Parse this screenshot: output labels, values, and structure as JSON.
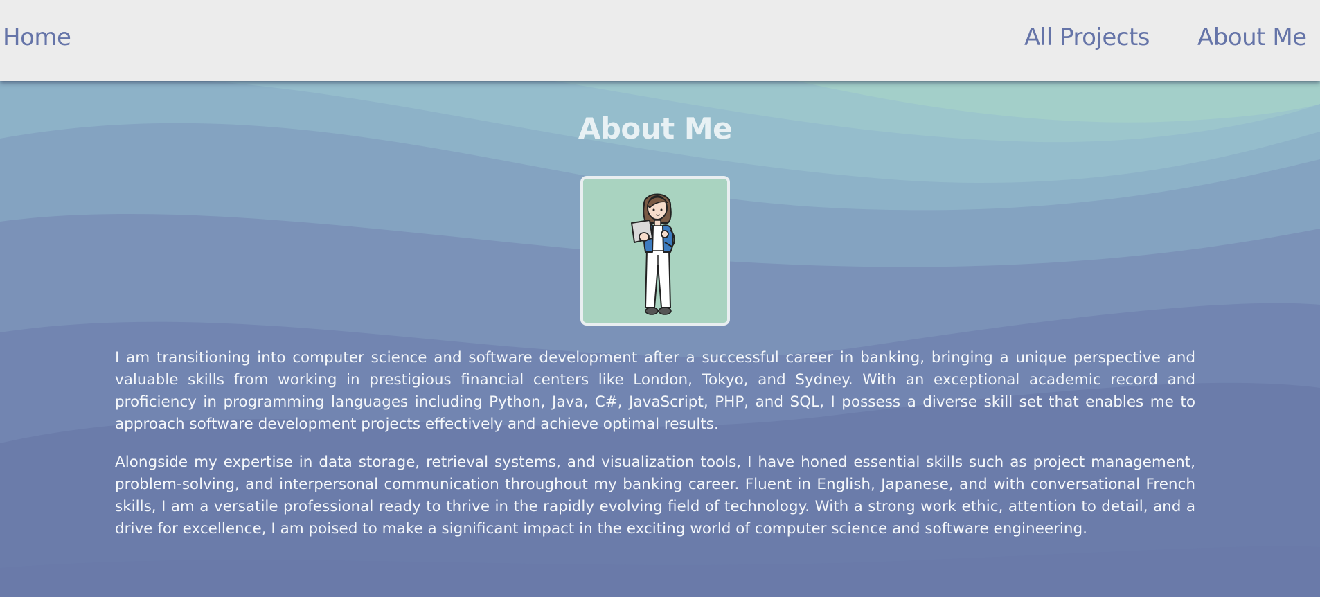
{
  "nav": {
    "home_label": "Home",
    "projects_label": "All Projects",
    "about_label": "About Me"
  },
  "main": {
    "title": "About Me",
    "portrait": {
      "icon": "woman-with-laptop-illustration",
      "background_color": "#a9d3c0"
    },
    "paragraphs": [
      "I am transitioning into computer science and software development after a successful career in banking, bringing a unique perspective and valuable skills from working in prestigious financial centers like London, Tokyo, and Sydney. With an exceptional academic record and proficiency in programming languages including Python, Java, C#, JavaScript, PHP, and SQL, I possess a diverse skill set that enables me to approach software development projects effectively and achieve optimal results.",
      "Alongside my expertise in data storage, retrieval systems, and visualization tools, I have honed essential skills such as project management, problem-solving, and interpersonal communication throughout my banking career. Fluent in English, Japanese, and with conversational French skills, I am a versatile professional ready to thrive in the rapidly evolving field of technology. With a strong work ethic, attention to detail, and a drive for excellence, I am poised to make a significant impact in the exciting world of computer science and software engineering."
    ]
  },
  "colors": {
    "nav_background": "#ececec",
    "nav_link": "#6574a8",
    "heading": "#e8f1f4",
    "body_text": "#f4f7fa",
    "wave_light": "#a3cfc9",
    "wave_dark": "#6b7caa"
  }
}
